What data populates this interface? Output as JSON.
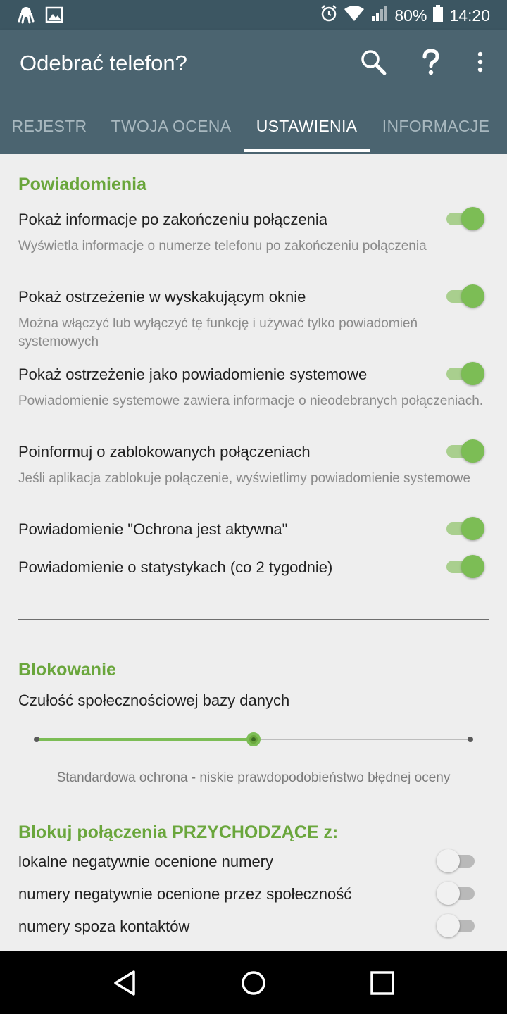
{
  "status_bar": {
    "left_icons": [
      "octopus-notification-icon",
      "image-notification-icon"
    ],
    "right_icons": [
      "alarm-icon",
      "wifi-icon",
      "signal-icon",
      "battery-icon"
    ],
    "battery": "80%",
    "time": "14:20"
  },
  "app_bar": {
    "title": "Odebrać telefon?",
    "actions": [
      "search-icon",
      "help-icon",
      "more-vert-icon"
    ]
  },
  "tabs": [
    {
      "label": "REJESTR",
      "active": false
    },
    {
      "label": "TWOJA OCENA",
      "active": false
    },
    {
      "label": "USTAWIENIA",
      "active": true
    },
    {
      "label": "INFORMACJE",
      "active": false
    }
  ],
  "notifications": {
    "header": "Powiadomienia",
    "items": [
      {
        "title": "Pokaż informacje po zakończeniu połączenia",
        "summary": "Wyświetla informacje o numerze telefonu po zakończeniu połączenia",
        "enabled": true
      },
      {
        "title": "Pokaż ostrzeżenie w wyskakującym oknie",
        "summary": "Można włączyć lub wyłączyć tę funkcję i używać tylko powiadomień systemowych",
        "enabled": true
      },
      {
        "title": "Pokaż ostrzeżenie jako powiadomienie systemowe",
        "summary": "Powiadomienie systemowe zawiera informacje o nieodebranych połączeniach.",
        "enabled": true
      },
      {
        "title": "Poinformuj o zablokowanych połączeniach",
        "summary": "Jeśli aplikacja zablokuje połączenie, wyświetlimy powiadomienie systemowe",
        "enabled": true
      },
      {
        "title": "Powiadomienie \"Ochrona jest aktywna\"",
        "enabled": true
      },
      {
        "title": "Powiadomienie o statystykach (co 2 tygodnie)",
        "enabled": true
      }
    ]
  },
  "blocking": {
    "header": "Blokowanie",
    "sensitivity_label": "Czułość społecznościowej bazy danych",
    "sensitivity_level": 0.5,
    "sensitivity_steps": 3,
    "sensitivity_caption": "Standardowa ochrona - niskie prawdopodobieństwo błędnej oceny"
  },
  "block_incoming": {
    "header": "Blokuj połączenia PRZYCHODZĄCE z:",
    "items": [
      {
        "label": "lokalne negatywnie ocenione numery",
        "enabled": false
      },
      {
        "label": "numery negatywnie ocenione przez społeczność",
        "enabled": false
      },
      {
        "label": "numery spoza kontaktów",
        "enabled": false
      }
    ]
  },
  "colors": {
    "app_bar": "#4b6470",
    "status_bar": "#3c5662",
    "accent_green": "#6aa63c",
    "switch_on": "#7cbd55"
  }
}
